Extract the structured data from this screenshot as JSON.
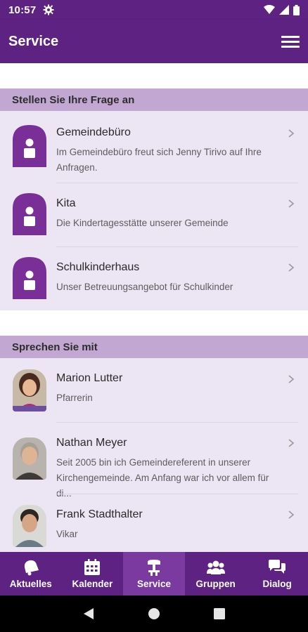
{
  "status_bar": {
    "time": "10:57"
  },
  "app_bar": {
    "title": "Service"
  },
  "sections": [
    {
      "header": "Stellen Sie Ihre Frage an",
      "items": [
        {
          "title": "Gemeindebüro",
          "subtitle": "Im Gemeindebüro freut sich Jenny Tirivo auf Ihre Anfragen."
        },
        {
          "title": "Kita",
          "subtitle": "Die Kindertagesstätte unserer Gemeinde"
        },
        {
          "title": "Schulkinderhaus",
          "subtitle": "Unser Betreuungsangebot für Schulkinder"
        }
      ]
    },
    {
      "header": "Sprechen Sie mit",
      "items": [
        {
          "title": "Marion Lutter",
          "subtitle": "Pfarrerin"
        },
        {
          "title": "Nathan Meyer",
          "subtitle": "Seit 2005 bin ich Gemeindereferent in unserer Kirchengemeinde. Am Anfang war ich vor allem für di..."
        },
        {
          "title": "Frank Stadthalter",
          "subtitle": "Vikar"
        }
      ]
    }
  ],
  "bottom_nav": [
    {
      "label": "Aktuelles",
      "icon": "bell-icon"
    },
    {
      "label": "Kalender",
      "icon": "calendar-icon"
    },
    {
      "label": "Service",
      "icon": "service-icon",
      "active": true
    },
    {
      "label": "Gruppen",
      "icon": "groups-icon"
    },
    {
      "label": "Dialog",
      "icon": "chat-icon"
    }
  ],
  "colors": {
    "primary": "#5e2282",
    "active_tab": "#7a3aa0",
    "section_header": "#c2a7d3",
    "list_background": "#ece5f3"
  }
}
